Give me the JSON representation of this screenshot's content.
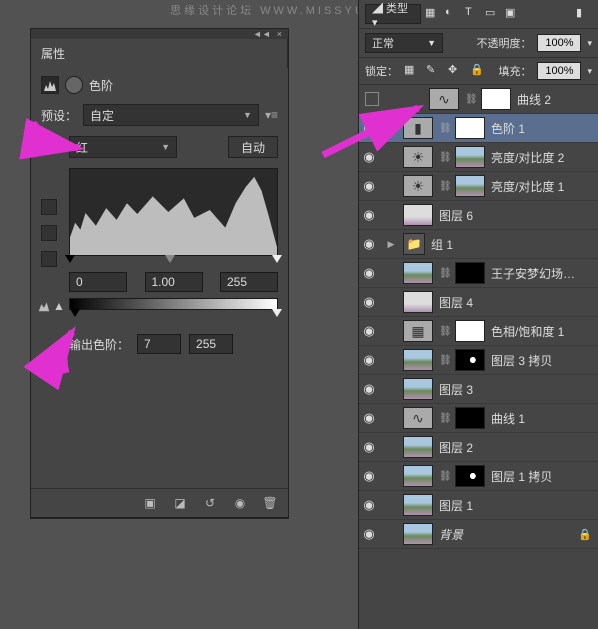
{
  "watermark": "思缘设计论坛 WWW.MISSYUAN.COM",
  "props": {
    "title": "属性",
    "adj_label": "色阶",
    "preset_label": "预设：",
    "preset_value": "自定",
    "channel_value": "红",
    "auto_label": "自动",
    "input_black": "0",
    "input_gamma": "1.00",
    "input_white": "255",
    "output_label": "输出色阶：",
    "output_black": "7",
    "output_white": "255"
  },
  "layer_opts": {
    "blend": "正常",
    "opacity_label": "不透明度：",
    "opacity_value": "100%",
    "lock_label": "锁定：",
    "fill_label": "填充：",
    "fill_value": "100%"
  },
  "layers": [
    {
      "vis": false,
      "thumbs": [
        "adj",
        "white"
      ],
      "name": "曲线 2",
      "sel": false,
      "adj": "curve"
    },
    {
      "vis": true,
      "thumbs": [
        "adj",
        "white"
      ],
      "name": "色阶 1",
      "sel": true,
      "adj": "levels"
    },
    {
      "vis": true,
      "thumbs": [
        "adj",
        "img"
      ],
      "name": "亮度/对比度 2",
      "sel": false,
      "adj": "bc"
    },
    {
      "vis": true,
      "thumbs": [
        "adj",
        "img"
      ],
      "name": "亮度/对比度 1",
      "sel": false,
      "adj": "bc"
    },
    {
      "vis": true,
      "thumbs": [
        "img2"
      ],
      "name": "图层 6",
      "sel": false
    },
    {
      "vis": true,
      "thumbs": [
        "group"
      ],
      "name": "组 1",
      "sel": false,
      "exp": "▶"
    },
    {
      "vis": true,
      "thumbs": [
        "img",
        "black"
      ],
      "name": "王子安梦幻场…",
      "sel": false
    },
    {
      "vis": true,
      "thumbs": [
        "img2"
      ],
      "name": "图层 4",
      "sel": false
    },
    {
      "vis": true,
      "thumbs": [
        "adj",
        "white"
      ],
      "name": "色相/饱和度 1",
      "sel": false,
      "adj": "hue"
    },
    {
      "vis": true,
      "thumbs": [
        "img",
        "dot"
      ],
      "name": "图层 3 拷贝",
      "sel": false
    },
    {
      "vis": true,
      "thumbs": [
        "img"
      ],
      "name": "图层 3",
      "sel": false
    },
    {
      "vis": true,
      "thumbs": [
        "adj",
        "black"
      ],
      "name": "曲线 1",
      "sel": false,
      "adj": "curve"
    },
    {
      "vis": true,
      "thumbs": [
        "img"
      ],
      "name": "图层 2",
      "sel": false
    },
    {
      "vis": true,
      "thumbs": [
        "img",
        "dot"
      ],
      "name": "图层 1 拷贝",
      "sel": false
    },
    {
      "vis": true,
      "thumbs": [
        "img"
      ],
      "name": "图层 1",
      "sel": false
    },
    {
      "vis": true,
      "thumbs": [
        "img"
      ],
      "name": "背景",
      "sel": false,
      "locked": true,
      "italic": true
    }
  ]
}
